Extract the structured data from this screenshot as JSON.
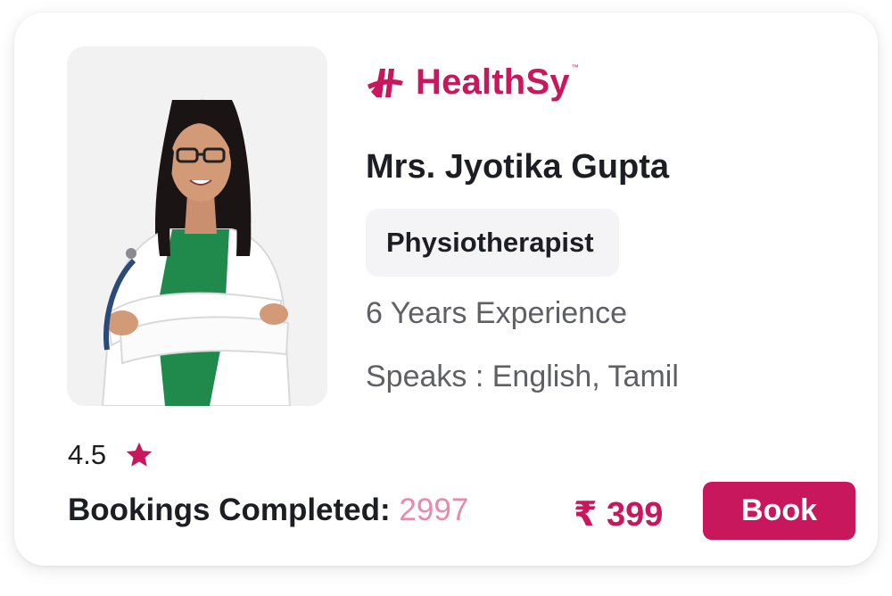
{
  "brand": {
    "name": "HealthSy",
    "trademark": "™",
    "logo_icon": "healthsy-logo-icon"
  },
  "doctor": {
    "name": "Mrs. Jyotika Gupta",
    "specialty": "Physiotherapist",
    "experience": "6 Years Experience",
    "languages": "Speaks : English, Tamil",
    "photo": "doctor-photo"
  },
  "rating": {
    "value": "4.5",
    "icon": "star-icon"
  },
  "bookings": {
    "label": "Bookings Completed:",
    "count": "2997"
  },
  "price": "₹ 399",
  "book_button": {
    "label": "Book"
  },
  "colors": {
    "brand": "#c8175c",
    "booking_count": "#e88aac",
    "text_primary": "#1d1d24",
    "text_secondary": "#5f5f66",
    "badge_bg": "#f4f4f6",
    "photo_bg": "#f2f2f2"
  }
}
